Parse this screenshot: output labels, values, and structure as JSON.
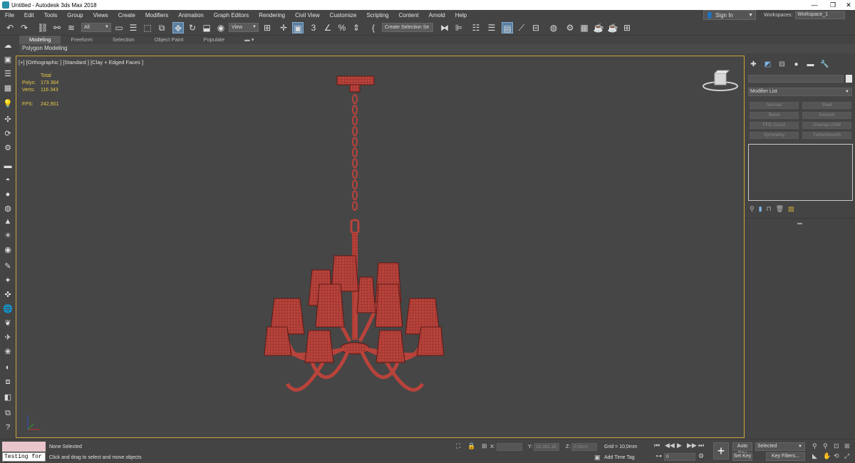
{
  "window": {
    "title": "Untitled - Autodesk 3ds Max 2018",
    "minimize": "—",
    "restore": "❐",
    "close": "✕"
  },
  "menu": [
    "File",
    "Edit",
    "Tools",
    "Group",
    "Views",
    "Create",
    "Modifiers",
    "Animation",
    "Graph Editors",
    "Rendering",
    "Civil View",
    "Customize",
    "Scripting",
    "Content",
    "Arnold",
    "Help"
  ],
  "signin": {
    "label": "Sign In"
  },
  "workspaces": {
    "label": "Workspaces:",
    "value": "Workspace_1"
  },
  "toolbar": {
    "filter_value": "All",
    "refcoord_value": "View",
    "selection_set_placeholder": "Create Selection Se"
  },
  "ribbon": {
    "tabs": [
      "Modeling",
      "Freeform",
      "Selection",
      "Object Paint",
      "Populate"
    ],
    "active_tab": "Modeling",
    "panel_label": "Polygon Modeling"
  },
  "viewport": {
    "label": "[+] [Orthographic ] [Standard ] [Clay + Edged Faces ]",
    "stats": {
      "header": "Total",
      "polys_label": "Polys:",
      "polys_value": "173 364",
      "verts_label": "Verts:",
      "verts_value": "116 343",
      "fps_label": "FPS:",
      "fps_value": "242,901"
    },
    "model_color": "#b8433b"
  },
  "command_panel": {
    "modifier_list": "Modifier List",
    "buttons": [
      "Normal",
      "Shell",
      "Bend",
      "Smooth",
      "FFD 2x2x2",
      "Unwrap UVW",
      "Symmetry",
      "TurboSmooth"
    ]
  },
  "status": {
    "maxscript_input": "Testing for i",
    "selection_text": "None Selected",
    "prompt_text": "Click and drag to select and move objects",
    "x_label": "X:",
    "x_value": "",
    "y_label": "Y:",
    "y_value": "28,082,3E",
    "z_label": "Z:",
    "z_value": "0,0mm",
    "grid_text": "Grid = 10,0mm",
    "add_time_tag": "Add Time Tag",
    "frame_value": "0",
    "auto_key": "Auto Key",
    "set_key": "Set Key",
    "selected_value": "Selected",
    "key_filters": "Key Filters..."
  }
}
